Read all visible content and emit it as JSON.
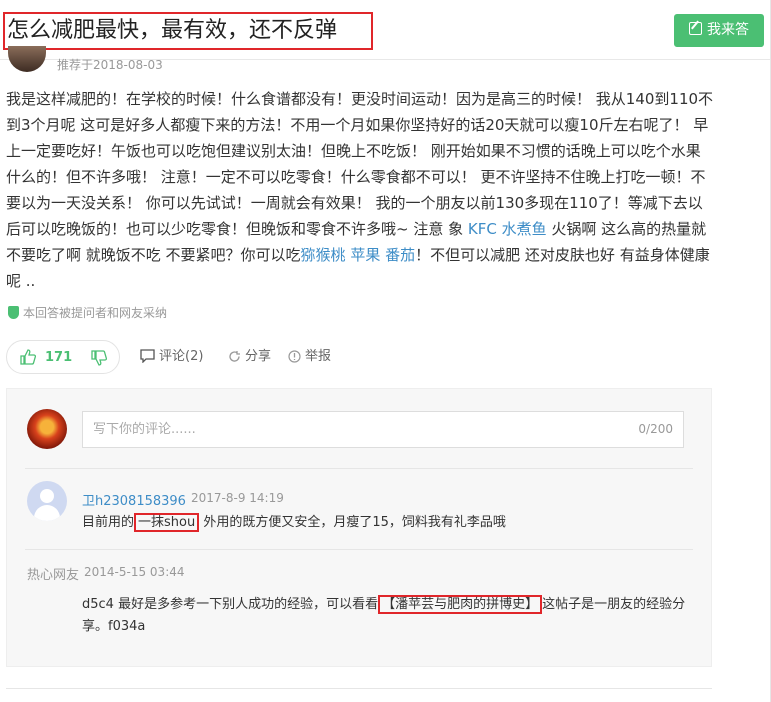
{
  "question": {
    "title": "怎么减肥最快，最有效，还不反弹",
    "answer_button": "我来答"
  },
  "answer": {
    "recommend_date": "推荐于2018-08-03",
    "body_text_1": "我是这样减肥的！在学校的时候！什么食谱都没有！更没时间运动！因为是高三的时候！ 我从140到110不到3个月呢 这可是好多人都瘦下来的方法！不用一个月如果你坚持好的话20天就可以瘦10斤左右呢了！ 早上一定要吃好！午饭也可以吃饱但建议别太油！但晚上不吃饭！ 刚开始如果不习惯的话晚上可以吃个水果什么的！但不许多哦！ 注意！一定不可以吃零食！什么零食都不可以！ 更不许坚持不住晚上打吃一顿！不要以为一天没关系！ 你可以先试试！一周就会有效果！ 我的一个朋友以前130多现在110了！等减下去以后可以吃晚饭的！也可以少吃零食！但晚饭和零食不许多哦~ 注意 象",
    "link_kfc": "KFC",
    "link_fish": "水煮鱼",
    "body_text_2": " 火锅啊 这么高的热量就不要吃了啊 就晚饭不吃 不要紧吧？你可以吃",
    "link_kiwi": "猕猴桃",
    "link_apple": "苹果",
    "link_tomato": "番茄",
    "body_text_3": "！不但可以减肥 还对皮肤也好 有益身体健康呢 ..",
    "adopted_note": "本回答被提问者和网友采纳"
  },
  "actions": {
    "like_count": "171",
    "comment_label": "评论(2)",
    "share_label": "分享",
    "report_label": "举报"
  },
  "comments": {
    "input_placeholder": "写下你的评论......",
    "input_counter": "0/200",
    "items": [
      {
        "user": "卫h2308158396",
        "date": "2017-8-9 14:19",
        "text_before": "目前用的",
        "highlight": "一抹shou",
        "text_after": " 外用的既方便又安全，月瘦了15，饲料我有礼李品哦"
      },
      {
        "user": "热心网友",
        "date": "2014-5-15 03:44",
        "text_before": "d5c4 最好是多参考一下别人成功的经验，可以看看",
        "highlight": "【潘苹芸与肥肉的拼博史】",
        "text_after": "这帖子是一朋友的经验分享。f034a"
      }
    ]
  },
  "colors": {
    "accent_green": "#4bbf73",
    "link_blue": "#3e8dc7",
    "highlight_red": "#e0262a"
  }
}
